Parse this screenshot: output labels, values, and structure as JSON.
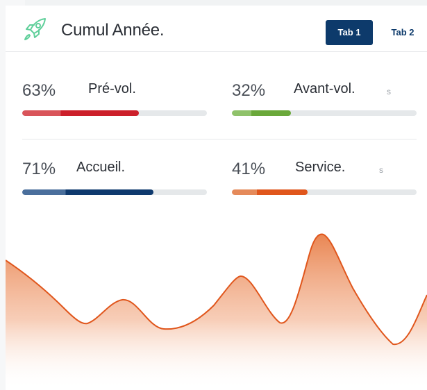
{
  "header": {
    "title": "Cumul Année.",
    "tabs": [
      {
        "label": "Tab 1",
        "active": true
      },
      {
        "label": "Tab 2",
        "active": false
      }
    ]
  },
  "stats": [
    {
      "percent": "63%",
      "label": "Pré-vol.",
      "progress": 0.63,
      "color_light": "#d9545a",
      "color_dark": "#cc1f2a",
      "ghost": ""
    },
    {
      "percent": "32%",
      "label": "Avant-vol.",
      "progress": 0.32,
      "color_light": "#8fc26a",
      "color_dark": "#6aa83a",
      "ghost": "s"
    },
    {
      "percent": "71%",
      "label": "Accueil.",
      "progress": 0.71,
      "color_light": "#4a6f9c",
      "color_dark": "#0f3a6e",
      "ghost": ""
    },
    {
      "percent": "41%",
      "label": "Service.",
      "progress": 0.41,
      "color_light": "#e58a5a",
      "color_dark": "#e0561c",
      "ghost": "s"
    }
  ],
  "colors": {
    "accent": "#0d3a6b",
    "rocket": "#5fcf9a",
    "wave_line": "#e0561c",
    "wave_fill": "#e8804a"
  }
}
